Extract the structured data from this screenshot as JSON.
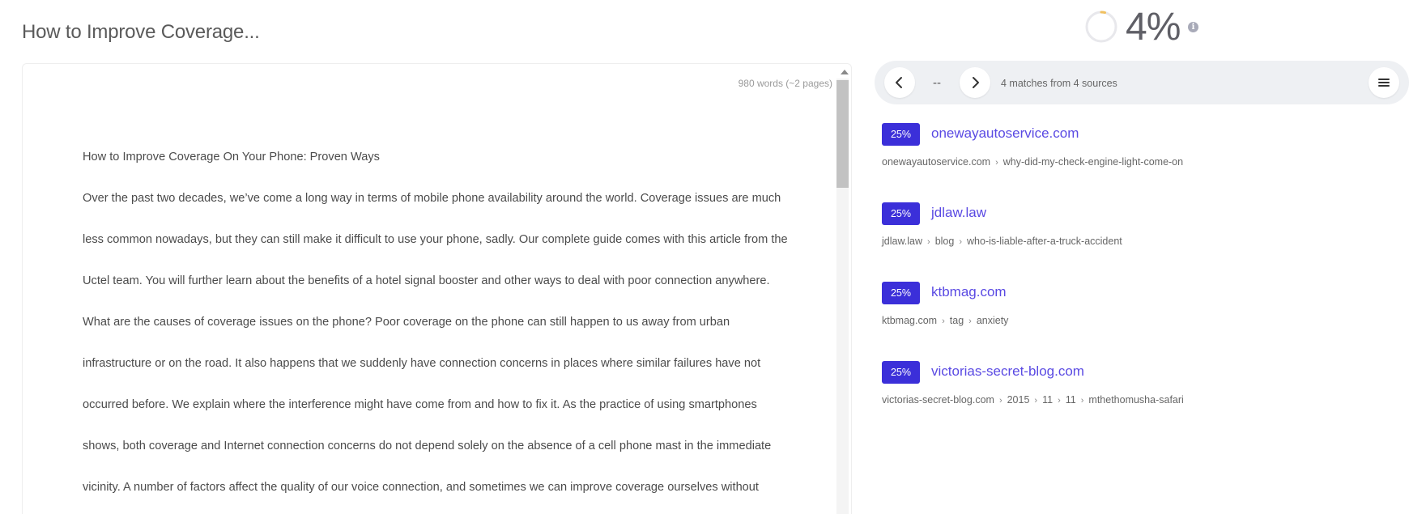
{
  "document": {
    "title": "How to Improve Coverage...",
    "word_count": "980 words (~2 pages)",
    "heading": "How to Improve Coverage On Your Phone: Proven Ways",
    "lines": [
      "Over the past two decades, we’ve come a long way in terms of mobile phone availability around the world. Coverage issues are much",
      "less common nowadays, but they can still make it difficult to use your phone, sadly. Our complete guide comes with this article from the",
      "Uctel team. You will further learn about the benefits of a hotel signal booster and other ways to deal with poor connection anywhere.",
      "What are the causes of coverage issues on the phone? Poor coverage on the phone can still happen to us away from urban",
      "infrastructure or on the road. It also happens that we suddenly have connection concerns in places where similar failures have not",
      "occurred before. We explain where the interference might have come from and how to fix it. As the practice of using smartphones",
      "shows, both coverage and Internet connection concerns do not depend solely on the absence of a cell phone mast in the immediate",
      "vicinity. A number of factors affect the quality of our voice connection, and sometimes we can improve coverage ourselves without"
    ]
  },
  "score": {
    "value": "4%",
    "fraction": 0.04,
    "ring_color": "#e8e8ec",
    "accent_color": "#f0c060"
  },
  "matches": {
    "current_index": "--",
    "summary": "4 matches from 4 sources",
    "prev_icon": "chevron-left-icon",
    "next_icon": "chevron-right-icon",
    "menu_icon": "hamburger-menu-icon"
  },
  "sources": [
    {
      "percent": "25%",
      "domain": "onewayautoservice.com",
      "path": [
        "onewayautoservice.com",
        "why-did-my-check-engine-light-come-on"
      ]
    },
    {
      "percent": "25%",
      "domain": "jdlaw.law",
      "path": [
        "jdlaw.law",
        "blog",
        "who-is-liable-after-a-truck-accident"
      ]
    },
    {
      "percent": "25%",
      "domain": "ktbmag.com",
      "path": [
        "ktbmag.com",
        "tag",
        "anxiety"
      ]
    },
    {
      "percent": "25%",
      "domain": "victorias-secret-blog.com",
      "path": [
        "victorias-secret-blog.com",
        "2015",
        "11",
        "11",
        "mthethomusha-safari"
      ]
    }
  ],
  "colors": {
    "badge": "#3b2fd9",
    "link": "#5a4ae3"
  }
}
